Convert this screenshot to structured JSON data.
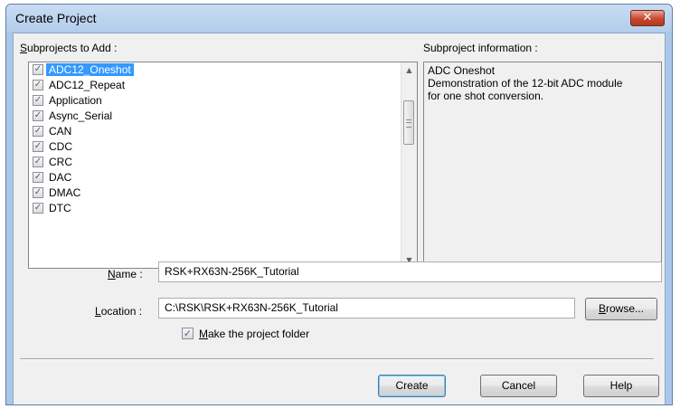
{
  "window": {
    "title": "Create Project",
    "close_symbol": "✕"
  },
  "subprojects": {
    "label_accel": "S",
    "label_rest": "ubprojects to Add :",
    "items": [
      {
        "label": "ADC12_Oneshot",
        "checked": true,
        "selected": true
      },
      {
        "label": "ADC12_Repeat",
        "checked": true,
        "selected": false
      },
      {
        "label": "Application",
        "checked": true,
        "selected": false
      },
      {
        "label": "Async_Serial",
        "checked": true,
        "selected": false
      },
      {
        "label": "CAN",
        "checked": true,
        "selected": false
      },
      {
        "label": "CDC",
        "checked": true,
        "selected": false
      },
      {
        "label": "CRC",
        "checked": true,
        "selected": false
      },
      {
        "label": "DAC",
        "checked": true,
        "selected": false
      },
      {
        "label": "DMAC",
        "checked": true,
        "selected": false
      },
      {
        "label": "DTC",
        "checked": true,
        "selected": false
      }
    ],
    "check_mark": "✓",
    "scroll_up": "▲",
    "scroll_down": "▼"
  },
  "info": {
    "label": "Subproject information :",
    "lines": [
      "ADC Oneshot",
      "Demonstration of the 12-bit ADC module",
      "for one shot conversion."
    ]
  },
  "name": {
    "label_accel": "N",
    "label_rest": "ame :",
    "value": "RSK+RX63N-256K_Tutorial"
  },
  "location": {
    "label_accel": "L",
    "label_rest": "ocation :",
    "value": "C:\\RSK\\RSK+RX63N-256K_Tutorial",
    "browse_accel": "B",
    "browse_rest": "rowse..."
  },
  "make_folder": {
    "label_accel": "M",
    "label_rest": "ake the project folder",
    "checked": true
  },
  "buttons": {
    "create": "Create",
    "cancel": "Cancel",
    "help": "Help"
  },
  "colors": {
    "selection": "#3399ff",
    "frame": "#aac7e8",
    "close": "#c7472e"
  }
}
